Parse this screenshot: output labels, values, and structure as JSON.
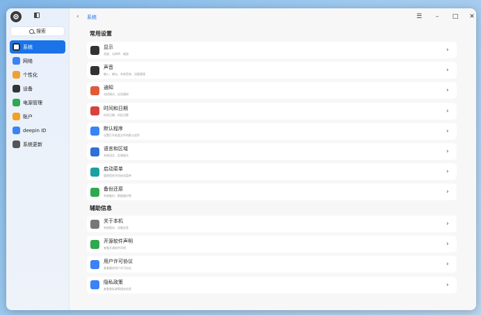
{
  "sidebar": {
    "search_label": "搜索",
    "items": [
      {
        "label": "系统",
        "icon": "system-icon",
        "color": "#2f6fd6",
        "active": true
      },
      {
        "label": "网络",
        "icon": "network-icon",
        "color": "#3b82f6"
      },
      {
        "label": "个性化",
        "icon": "personalization-icon",
        "color": "#f0a030"
      },
      {
        "label": "设备",
        "icon": "device-icon",
        "color": "#333333"
      },
      {
        "label": "电源管理",
        "icon": "power-icon",
        "color": "#2fa84f"
      },
      {
        "label": "账户",
        "icon": "account-icon",
        "color": "#f4a020"
      },
      {
        "label": "deepin ID",
        "icon": "cloud-icon",
        "color": "#3b82f6"
      },
      {
        "label": "系统更新",
        "icon": "update-icon",
        "color": "#555555"
      }
    ]
  },
  "titlebar": {
    "breadcrumb": "系统"
  },
  "sections": [
    {
      "title": "常用设置",
      "cards": [
        {
          "title": "显示",
          "sub": "亮度、分辨率、缩放",
          "icon": "display-icon",
          "color": "#333333"
        },
        {
          "title": "声音",
          "sub": "输入、输出、系统音效、设备管理",
          "icon": "sound-icon",
          "color": "#333333"
        },
        {
          "title": "通知",
          "sub": "勿扰模式、应用通知",
          "icon": "notification-icon",
          "color": "#e05a3a"
        },
        {
          "title": "时间和日期",
          "sub": "时间日期、时区设置",
          "icon": "calendar-icon",
          "color": "#d94040"
        },
        {
          "title": "默认程序",
          "sub": "设置打开各类文件的默认程序",
          "icon": "default-apps-icon",
          "color": "#3b82f6"
        },
        {
          "title": "语言和区域",
          "sub": "系统语言、区域格式",
          "icon": "language-icon",
          "color": "#2f6fd6"
        },
        {
          "title": "启动菜单",
          "sub": "管理您的开机启动菜单",
          "icon": "boot-menu-icon",
          "color": "#1aa0a0"
        },
        {
          "title": "备份还原",
          "sub": "系统备份、数据备份等",
          "icon": "backup-icon",
          "color": "#2fa84f"
        }
      ]
    },
    {
      "title": "辅助信息",
      "cards": [
        {
          "title": "关于本机",
          "sub": "系统版本、设备信息",
          "icon": "info-icon",
          "color": "#777777"
        },
        {
          "title": "开源软件声明",
          "sub": "查看开源软件声明",
          "icon": "open-source-icon",
          "color": "#2fa84f"
        },
        {
          "title": "用户许可协议",
          "sub": "查看最终用户许可协议",
          "icon": "license-icon",
          "color": "#3b82f6"
        },
        {
          "title": "隐私政策",
          "sub": "查看隐私政策相关信息",
          "icon": "privacy-icon",
          "color": "#3b82f6"
        }
      ]
    }
  ]
}
